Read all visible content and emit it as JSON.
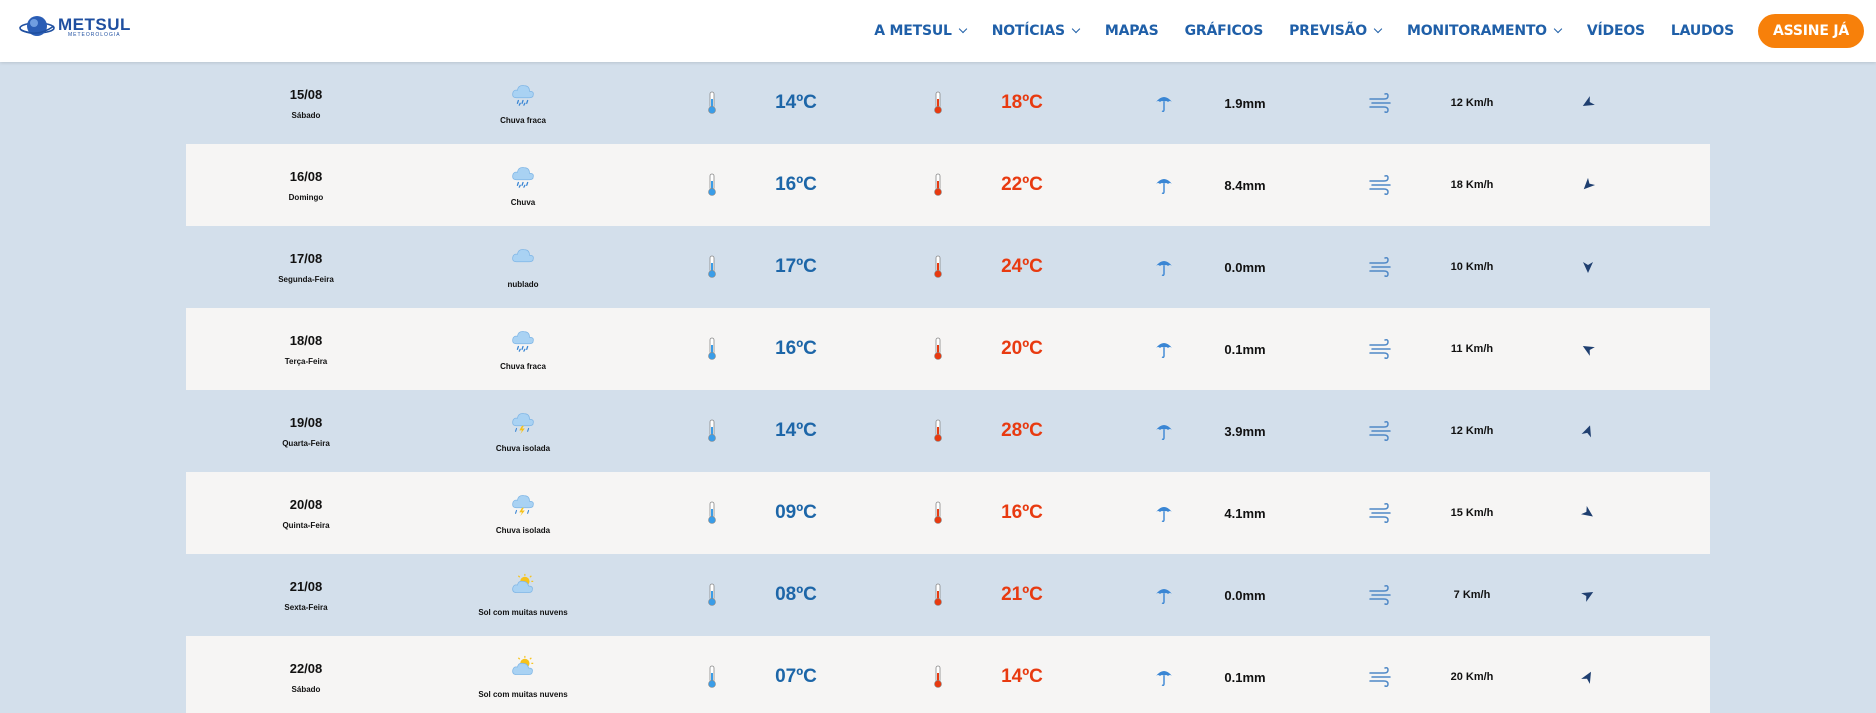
{
  "header": {
    "logo_text": "METSUL",
    "logo_sub": "METEOROLOGIA",
    "nav": [
      {
        "label": "A METSUL",
        "dropdown": true
      },
      {
        "label": "NOTÍCIAS",
        "dropdown": true
      },
      {
        "label": "MAPAS",
        "dropdown": false
      },
      {
        "label": "GRÁFICOS",
        "dropdown": false
      },
      {
        "label": "PREVISÃO",
        "dropdown": true
      },
      {
        "label": "MONITORAMENTO",
        "dropdown": true
      },
      {
        "label": "VÍDEOS",
        "dropdown": false
      },
      {
        "label": "LAUDOS",
        "dropdown": false
      }
    ],
    "cta_label": "ASSINE JÁ"
  },
  "colors": {
    "nav": "#1f5fa8",
    "cta": "#f7800a",
    "tmin": "#1d66a8",
    "tmax": "#e83a10",
    "row_bg": "#d3dfeb",
    "row_alt_bg": "#f6f5f4"
  },
  "forecast": [
    {
      "date": "15/08",
      "day": "Sábado",
      "condition": "Chuva fraca",
      "icon": "rain-cloud-icon",
      "tmin": "14ºC",
      "tmax": "18ºC",
      "rain": "1.9mm",
      "wind": "12 Km/h",
      "wind_dir_deg": 240
    },
    {
      "date": "16/08",
      "day": "Domingo",
      "condition": "Chuva",
      "icon": "rain-cloud-icon",
      "tmin": "16ºC",
      "tmax": "22ºC",
      "rain": "8.4mm",
      "wind": "18 Km/h",
      "wind_dir_deg": 225
    },
    {
      "date": "17/08",
      "day": "Segunda-Feira",
      "condition": "nublado",
      "icon": "cloud-icon",
      "tmin": "17ºC",
      "tmax": "24ºC",
      "rain": "0.0mm",
      "wind": "10 Km/h",
      "wind_dir_deg": 180
    },
    {
      "date": "18/08",
      "day": "Terça-Feira",
      "condition": "Chuva fraca",
      "icon": "rain-cloud-icon",
      "tmin": "16ºC",
      "tmax": "20ºC",
      "rain": "0.1mm",
      "wind": "11 Km/h",
      "wind_dir_deg": 300
    },
    {
      "date": "19/08",
      "day": "Quarta-Feira",
      "condition": "Chuva isolada",
      "icon": "storm-cloud-icon",
      "tmin": "14ºC",
      "tmax": "28ºC",
      "rain": "3.9mm",
      "wind": "12 Km/h",
      "wind_dir_deg": 20
    },
    {
      "date": "20/08",
      "day": "Quinta-Feira",
      "condition": "Chuva isolada",
      "icon": "storm-cloud-icon",
      "tmin": "09ºC",
      "tmax": "16ºC",
      "rain": "4.1mm",
      "wind": "15 Km/h",
      "wind_dir_deg": 125
    },
    {
      "date": "21/08",
      "day": "Sexta-Feira",
      "condition": "Sol com muitas nuvens",
      "icon": "sun-cloud-icon",
      "tmin": "08ºC",
      "tmax": "21ºC",
      "rain": "0.0mm",
      "wind": "7 Km/h",
      "wind_dir_deg": 60
    },
    {
      "date": "22/08",
      "day": "Sábado",
      "condition": "Sol com muitas nuvens",
      "icon": "sun-cloud-icon",
      "tmin": "07ºC",
      "tmax": "14ºC",
      "rain": "0.1mm",
      "wind": "20 Km/h",
      "wind_dir_deg": 30
    }
  ]
}
